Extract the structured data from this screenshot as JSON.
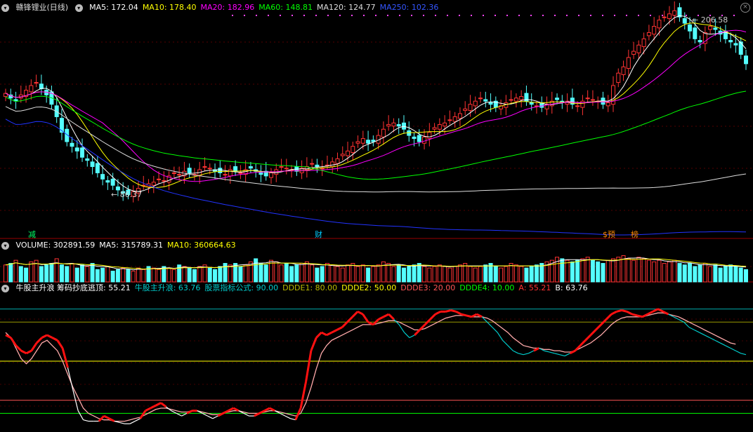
{
  "stock_name": "赣锋锂业(日线)",
  "price_header": [
    {
      "label": "MA5: 172.04",
      "color": "#ffffff"
    },
    {
      "label": "MA10: 178.40",
      "color": "#ffff00"
    },
    {
      "label": "MA20: 182.96",
      "color": "#ff00ff"
    },
    {
      "label": "MA60: 148.81",
      "color": "#00ff00"
    },
    {
      "label": "MA120: 124.77",
      "color": "#dddddd"
    },
    {
      "label": "MA250: 102.36",
      "color": "#3355ff"
    }
  ],
  "price_annotations": {
    "high_label": "206.58",
    "low_label": "86.37"
  },
  "event_markers": [
    {
      "text": "减",
      "color": "#00ff66"
    },
    {
      "text": "财",
      "color": "#00ccff"
    },
    {
      "text": "$预",
      "color": "#ff8800"
    },
    {
      "text": "榜",
      "color": "#ff8800"
    }
  ],
  "volume_header": [
    {
      "label": "VOLUME: 302891.59",
      "color": "#ffffff"
    },
    {
      "label": "MA5: 315789.31",
      "color": "#ffffff"
    },
    {
      "label": "MA10: 360664.63",
      "color": "#ffff00"
    }
  ],
  "indicator_header": [
    {
      "label": "牛股主升浪 筹码抄底逃顶: 55.21",
      "color": "#ffffff"
    },
    {
      "label": "牛股主升浪: 63.76",
      "color": "#00cccc"
    },
    {
      "label": "股票指标公式: 90.00",
      "color": "#00cccc"
    },
    {
      "label": "DDDE1: 80.00",
      "color": "#bbbb00"
    },
    {
      "label": "DDDE2: 50.00",
      "color": "#ffff00"
    },
    {
      "label": "DDDE3: 20.00",
      "color": "#ff5555"
    },
    {
      "label": "DDDE4: 10.00",
      "color": "#00ff00"
    },
    {
      "label": "A: 55.21",
      "color": "#ff3333"
    },
    {
      "label": "B: 63.76",
      "color": "#ffffff"
    }
  ],
  "chart_data": [
    {
      "type": "candlestick",
      "y_range": [
        80,
        215
      ],
      "close": [
        165,
        162,
        160,
        164,
        167,
        170,
        172,
        168,
        164,
        158,
        150,
        140,
        134,
        131,
        128,
        124,
        122,
        118,
        114,
        110,
        108,
        106,
        103,
        101,
        100,
        102,
        104,
        106,
        107,
        108,
        110,
        109,
        112,
        114,
        113,
        115,
        114,
        113,
        116,
        118,
        117,
        115,
        114,
        113,
        116,
        115,
        114,
        116,
        117,
        115,
        113,
        112,
        114,
        116,
        118,
        117,
        116,
        115,
        117,
        118,
        120,
        118,
        117,
        119,
        121,
        123,
        126,
        128,
        131,
        134,
        136,
        133,
        134,
        138,
        142,
        145,
        146,
        144,
        142,
        138,
        136,
        134,
        137,
        140,
        143,
        145,
        146,
        148,
        150,
        152,
        155,
        158,
        160,
        162,
        160,
        158,
        156,
        157,
        159,
        161,
        162,
        163,
        160,
        158,
        157,
        156,
        158,
        160,
        161,
        159,
        160,
        158,
        157,
        160,
        162,
        161,
        160,
        158,
        159,
        170,
        178,
        182,
        188,
        192,
        196,
        200,
        204,
        208,
        212,
        214,
        216,
        218,
        214,
        210,
        205,
        200,
        198,
        204,
        208,
        206,
        203,
        200,
        198,
        196,
        190,
        184
      ],
      "ma_periods": [
        5,
        10,
        20,
        60,
        120,
        250
      ],
      "ma_colors": [
        "#ffffff",
        "#ffff00",
        "#ff00ff",
        "#00ff00",
        "#dddddd",
        "#2233ff"
      ]
    },
    {
      "type": "bar",
      "title": "VOLUME",
      "volume": [
        0.55,
        0.6,
        0.7,
        0.5,
        0.45,
        0.65,
        0.7,
        0.5,
        0.55,
        0.6,
        0.75,
        0.55,
        0.5,
        0.6,
        0.45,
        0.55,
        0.5,
        0.6,
        0.4,
        0.45,
        0.5,
        0.35,
        0.4,
        0.45,
        0.4,
        0.35,
        0.45,
        0.4,
        0.5,
        0.45,
        0.4,
        0.5,
        0.45,
        0.4,
        0.55,
        0.5,
        0.45,
        0.4,
        0.5,
        0.55,
        0.45,
        0.4,
        0.5,
        0.6,
        0.55,
        0.6,
        0.5,
        0.55,
        0.65,
        0.75,
        0.6,
        0.55,
        0.7,
        0.65,
        0.55,
        0.6,
        0.5,
        0.55,
        0.6,
        0.65,
        0.55,
        0.45,
        0.5,
        0.6,
        0.55,
        0.5,
        0.45,
        0.55,
        0.6,
        0.5,
        0.55,
        0.45,
        0.5,
        0.55,
        0.65,
        0.6,
        0.5,
        0.55,
        0.45,
        0.5,
        0.55,
        0.6,
        0.5,
        0.45,
        0.5,
        0.55,
        0.5,
        0.45,
        0.5,
        0.55,
        0.6,
        0.5,
        0.45,
        0.5,
        0.55,
        0.6,
        0.5,
        0.45,
        0.5,
        0.6,
        0.55,
        0.5,
        0.45,
        0.5,
        0.55,
        0.6,
        0.65,
        0.7,
        0.8,
        0.75,
        0.7,
        0.65,
        0.7,
        0.75,
        0.8,
        0.7,
        0.65,
        0.6,
        0.7,
        0.75,
        0.8,
        0.85,
        0.75,
        0.7,
        0.8,
        0.75,
        0.7,
        0.65,
        0.7,
        0.6,
        0.65,
        0.7,
        0.6,
        0.55,
        0.6,
        0.5,
        0.55,
        0.6,
        0.5,
        0.55,
        0.45,
        0.5,
        0.55,
        0.5,
        0.45,
        0.4
      ],
      "up": [
        true,
        false,
        true,
        false,
        false,
        true,
        true,
        false,
        false,
        false,
        true,
        false,
        false,
        true,
        false,
        false,
        true,
        false,
        false,
        false,
        true,
        false,
        false,
        true,
        false,
        true,
        true,
        true,
        false,
        true,
        true,
        false,
        true,
        true,
        false,
        true,
        false,
        false,
        true,
        true,
        false,
        false,
        false,
        false,
        true,
        false,
        false,
        true,
        true,
        false,
        false,
        false,
        true,
        true,
        true,
        false,
        false,
        false,
        true,
        true,
        true,
        false,
        false,
        true,
        true,
        true,
        true,
        true,
        true,
        true,
        true,
        false,
        true,
        true,
        true,
        true,
        true,
        false,
        false,
        false,
        false,
        false,
        true,
        true,
        true,
        true,
        true,
        true,
        true,
        true,
        true,
        true,
        true,
        true,
        false,
        false,
        false,
        true,
        true,
        true,
        true,
        true,
        false,
        false,
        false,
        false,
        true,
        true,
        true,
        false,
        true,
        false,
        false,
        true,
        true,
        false,
        false,
        false,
        true,
        true,
        true,
        true,
        true,
        true,
        true,
        true,
        true,
        true,
        true,
        true,
        true,
        true,
        false,
        false,
        false,
        false,
        false,
        true,
        true,
        false,
        false,
        false,
        false,
        false,
        false,
        false
      ]
    },
    {
      "type": "line",
      "y_range": [
        0,
        100
      ],
      "levels": [
        {
          "name": "股票指标公式",
          "value": 90,
          "color": "#00aaaa"
        },
        {
          "name": "DDDE1",
          "value": 80,
          "color": "#999900"
        },
        {
          "name": "DDDE2",
          "value": 50,
          "color": "#ffff00"
        },
        {
          "name": "DDDE3",
          "value": 20,
          "color": "#ff5555"
        },
        {
          "name": "DDDE4",
          "value": 10,
          "color": "#00ff00"
        }
      ],
      "series": [
        {
          "name": "A",
          "color": "#ff2222",
          "values": [
            70,
            68,
            62,
            58,
            56,
            58,
            64,
            68,
            70,
            68,
            66,
            60,
            45,
            28,
            12,
            5,
            4,
            4,
            4,
            8,
            6,
            4,
            3,
            2,
            2,
            4,
            6,
            12,
            14,
            16,
            18,
            15,
            12,
            10,
            8,
            10,
            12,
            12,
            10,
            8,
            6,
            8,
            10,
            12,
            14,
            12,
            10,
            8,
            8,
            10,
            12,
            14,
            12,
            10,
            8,
            6,
            5,
            14,
            34,
            58,
            68,
            72,
            70,
            72,
            74,
            76,
            80,
            84,
            88,
            86,
            80,
            78,
            82,
            84,
            86,
            82,
            78,
            72,
            68,
            70,
            74,
            78,
            82,
            86,
            88,
            88,
            89,
            88,
            86,
            85,
            84,
            86,
            84,
            80,
            76,
            72,
            66,
            62,
            58,
            56,
            55,
            56,
            58,
            60,
            58,
            57,
            56,
            55,
            54,
            56,
            58,
            62,
            66,
            70,
            74,
            78,
            82,
            86,
            88,
            89,
            88,
            86,
            85,
            84,
            86,
            88,
            90,
            88,
            86,
            84,
            82,
            80,
            76,
            74,
            72,
            70,
            68,
            66,
            64,
            62,
            60,
            58,
            56,
            55
          ]
        },
        {
          "name": "B",
          "color": "#ffffff",
          "values": [
            72,
            68,
            60,
            52,
            48,
            52,
            58,
            64,
            66,
            62,
            58,
            50,
            40,
            30,
            22,
            14,
            10,
            8,
            6,
            5,
            5,
            4,
            4,
            4,
            5,
            6,
            7,
            9,
            11,
            13,
            14,
            14,
            13,
            12,
            11,
            11,
            12,
            12,
            11,
            10,
            9,
            9,
            10,
            11,
            12,
            12,
            11,
            10,
            10,
            10,
            11,
            12,
            12,
            11,
            10,
            9,
            8,
            10,
            18,
            30,
            44,
            56,
            62,
            66,
            68,
            70,
            72,
            74,
            76,
            78,
            78,
            78,
            79,
            80,
            81,
            81,
            80,
            78,
            76,
            74,
            74,
            75,
            77,
            79,
            81,
            83,
            84,
            85,
            85,
            85,
            84,
            84,
            84,
            83,
            81,
            78,
            75,
            72,
            68,
            65,
            62,
            61,
            60,
            60,
            59,
            59,
            58,
            58,
            57,
            57,
            58,
            60,
            62,
            64,
            67,
            70,
            74,
            78,
            81,
            83,
            84,
            84,
            84,
            84,
            85,
            86,
            87,
            87,
            86,
            85,
            84,
            82,
            80,
            78,
            76,
            74,
            72,
            70,
            68,
            66,
            64,
            63
          ]
        }
      ]
    }
  ]
}
